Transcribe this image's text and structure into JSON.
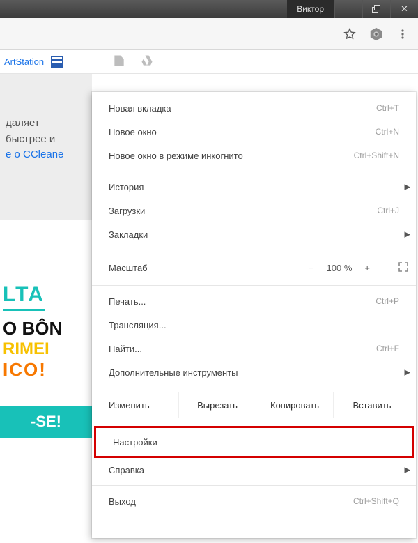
{
  "titlebar": {
    "profile": "Виктор"
  },
  "bookmarks": {
    "artstation": "ArtStation"
  },
  "page": {
    "ad_top_l1": "даляет",
    "ad_top_l2": "быстрее и",
    "ad_top_l3": "е о CCleane",
    "ad_mid_l1": "LTA",
    "ad_mid_l2": "O BÔN",
    "ad_mid_l3": "RIMEI",
    "ad_mid_l4": "ICO!",
    "ad_btn": "-SE!"
  },
  "menu": {
    "new_tab": "Новая вкладка",
    "new_tab_sc": "Ctrl+T",
    "new_window": "Новое окно",
    "new_window_sc": "Ctrl+N",
    "incognito": "Новое окно в режиме инкогнито",
    "incognito_sc": "Ctrl+Shift+N",
    "history": "История",
    "downloads": "Загрузки",
    "downloads_sc": "Ctrl+J",
    "bookmarks": "Закладки",
    "zoom_label": "Масштаб",
    "zoom_value": "100 %",
    "print": "Печать...",
    "print_sc": "Ctrl+P",
    "cast": "Трансляция...",
    "find": "Найти...",
    "find_sc": "Ctrl+F",
    "more_tools": "Дополнительные инструменты",
    "edit": "Изменить",
    "cut": "Вырезать",
    "copy": "Копировать",
    "paste": "Вставить",
    "settings": "Настройки",
    "help": "Справка",
    "exit": "Выход",
    "exit_sc": "Ctrl+Shift+Q"
  }
}
